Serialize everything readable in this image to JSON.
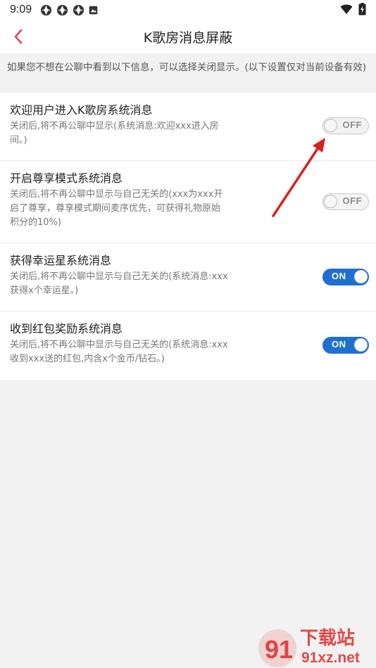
{
  "status_bar": {
    "time": "9:09",
    "icons_left": [
      "app-notification-icon",
      "app-notification-icon",
      "app-notification-icon",
      "photo-notification-icon"
    ],
    "icons_right": [
      "wifi-icon",
      "battery-charging-icon"
    ]
  },
  "header": {
    "title": "K歌房消息屏蔽",
    "back_icon": "chevron-left-icon"
  },
  "notice": "如果您不想在公聊中看到以下信息，可以选择关闭显示。(以下设置仅对当前设备有效)",
  "settings": [
    {
      "title": "欢迎用户进入K歌房系统消息",
      "desc": "关闭后,将不再公聊中显示(系统消息:欢迎xxx进入房间。)",
      "enabled": false,
      "label": "OFF"
    },
    {
      "title": "开启尊享模式系统消息",
      "desc": "关闭后,将不再公聊中显示与自己无关的(xxx为xxx开启了尊享，尊享模式期间麦序优先，可获得礼物原始积分的10%)",
      "enabled": false,
      "label": "OFF"
    },
    {
      "title": "获得幸运星系统消息",
      "desc": "关闭后,将不再公聊中显示与自己无关的(系统消息:xxx获得x个幸运星。)",
      "enabled": true,
      "label": "ON"
    },
    {
      "title": "收到红包奖励系统消息",
      "desc": "关闭后,将不再公聊中显示与自己无关的(系统消息:xxx收到xxx送的红包,内含x个金币/钻石。)",
      "enabled": true,
      "label": "ON"
    }
  ],
  "watermark": {
    "text_main": "下载站",
    "text_sub": "91xz.net",
    "logo_text": "91"
  },
  "colors": {
    "accent": "#e8415a",
    "toggle_on": "#1f6fd1",
    "arrow": "#d9211e"
  }
}
